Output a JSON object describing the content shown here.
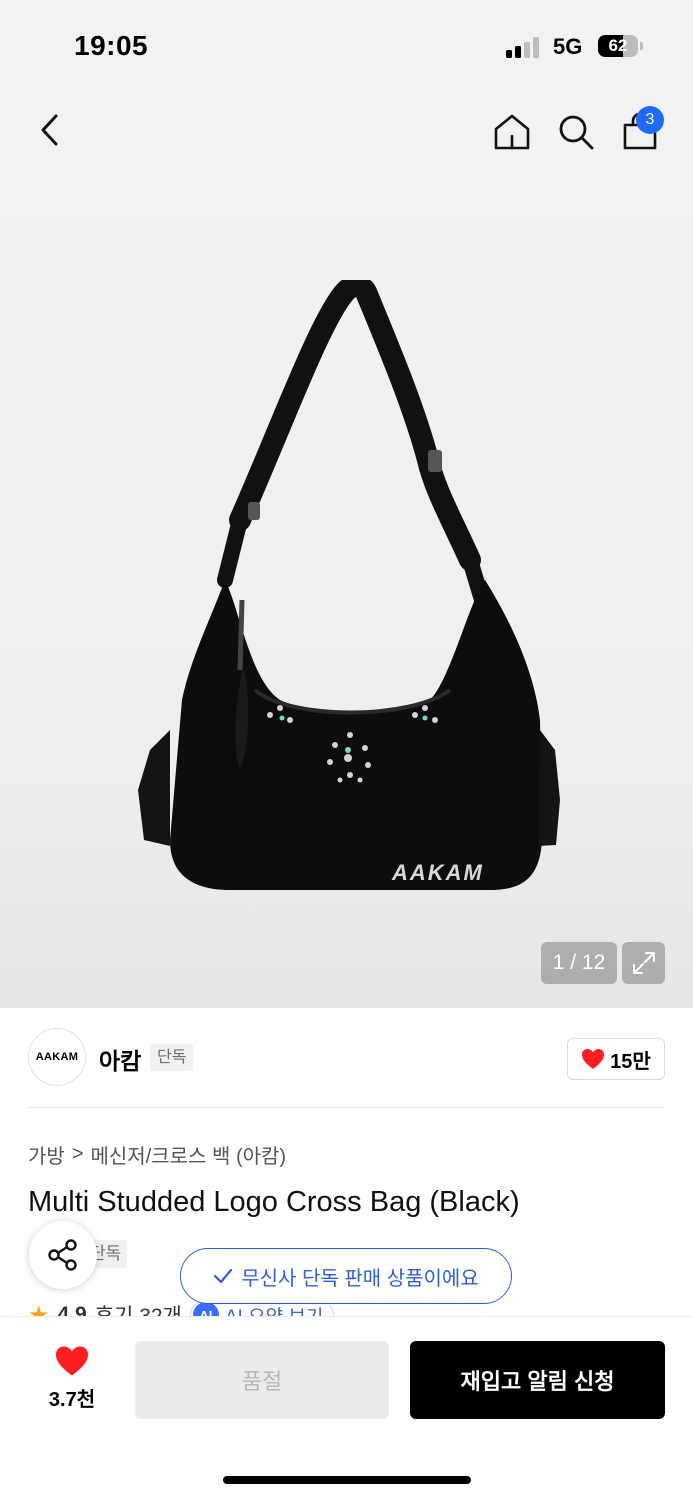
{
  "status_bar": {
    "time": "19:05",
    "network": "5G",
    "battery": "62",
    "battery_level": 0.62
  },
  "header": {
    "cart_count": "3"
  },
  "gallery": {
    "counter": "1 / 12",
    "bag_logo_text": "AAKAM"
  },
  "brand": {
    "logo_text": "AAKAM",
    "name": "아캄",
    "exclusive_label": "단독",
    "likes": "15만"
  },
  "breadcrumb": {
    "category": "가방",
    "separator": ">",
    "subcategory": "메신저/크로스 백 (아캄)"
  },
  "product": {
    "title": "Multi Studded Logo Cross Bag (Black)",
    "tag": "단독",
    "rating": "4.9",
    "reviews": "후기 32개",
    "ai_badge": "AI",
    "ai_summary_label": "AI 요약 보기"
  },
  "toast": {
    "text": "무신사 단독 판매 상품이에요"
  },
  "bottom_bar": {
    "like_count": "3.7천",
    "soldout_label": "품절",
    "restock_label": "재입고 알림 신청"
  },
  "colors": {
    "accent_blue": "#2f5de0",
    "badge_blue": "#1f6bff",
    "heart_red": "#ff1f1f",
    "star": "#f7a51c"
  }
}
